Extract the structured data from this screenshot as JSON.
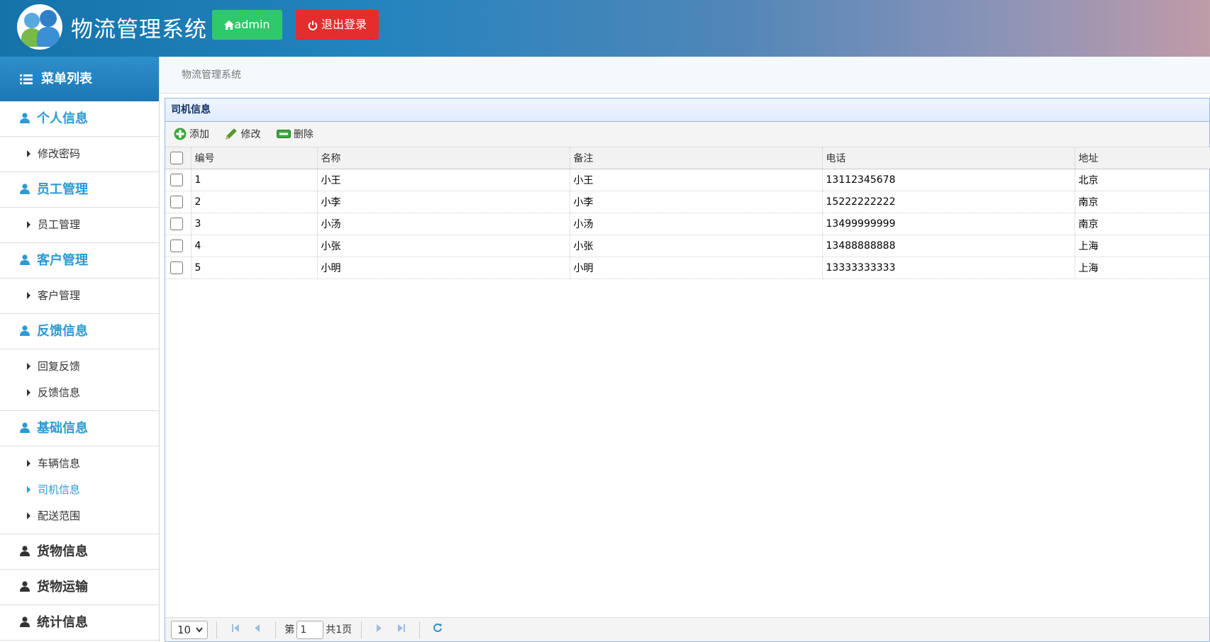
{
  "header": {
    "app_title": "物流管理系统",
    "user_label": "admin",
    "logout_label": "退出登录"
  },
  "sidebar": {
    "heading": "菜单列表",
    "groups": [
      {
        "label": "个人信息",
        "items": [
          {
            "label": "修改密码"
          }
        ]
      },
      {
        "label": "员工管理",
        "items": [
          {
            "label": "员工管理"
          }
        ]
      },
      {
        "label": "客户管理",
        "items": [
          {
            "label": "客户管理"
          }
        ]
      },
      {
        "label": "反馈信息",
        "items": [
          {
            "label": "回复反馈"
          },
          {
            "label": "反馈信息"
          }
        ]
      },
      {
        "label": "基础信息",
        "items": [
          {
            "label": "车辆信息"
          },
          {
            "label": "司机信息"
          },
          {
            "label": "配送范围"
          }
        ]
      },
      {
        "label": "货物信息",
        "items": []
      },
      {
        "label": "货物运输",
        "items": []
      },
      {
        "label": "统计信息",
        "items": []
      }
    ],
    "active_item": "司机信息"
  },
  "breadcrumb": "物流管理系统",
  "panel": {
    "title": "司机信息",
    "toolbar": {
      "add": "添加",
      "edit": "修改",
      "delete": "删除"
    },
    "columns": [
      "编号",
      "名称",
      "备注",
      "电话",
      "地址"
    ],
    "rows": [
      [
        "1",
        "小王",
        "小王",
        "13112345678",
        "北京"
      ],
      [
        "2",
        "小李",
        "小李",
        "15222222222",
        "南京"
      ],
      [
        "3",
        "小汤",
        "小汤",
        "13499999999",
        "南京"
      ],
      [
        "4",
        "小张",
        "小张",
        "13488888888",
        "上海"
      ],
      [
        "5",
        "小明",
        "小明",
        "13333333333",
        "上海"
      ]
    ]
  },
  "pager": {
    "page_size": "10",
    "page_prefix": "第",
    "current_page": "1",
    "total_pages": "共1页"
  },
  "colors": {
    "accent": "#2c9ad3",
    "admin_button": "#2fc86b",
    "logout_button": "#e52d2d",
    "panel_border": "#95b8e7"
  },
  "icons": {
    "menu_heading": "list-icon",
    "group": "user-icon",
    "admin": "home-icon",
    "logout": "power-icon",
    "add": "add-icon",
    "edit": "pencil-icon",
    "delete": "remove-icon"
  }
}
